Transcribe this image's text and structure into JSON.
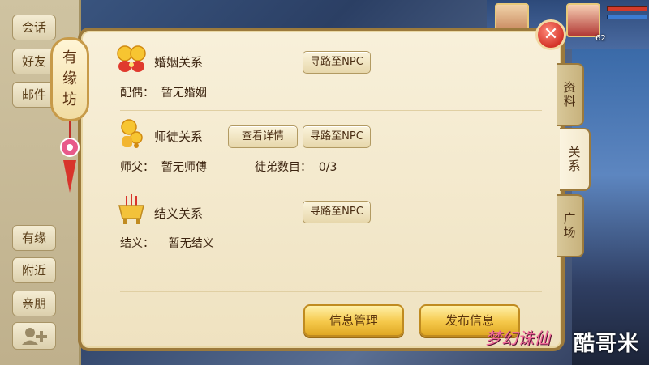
{
  "background": {
    "player_level": "62"
  },
  "left_nav": {
    "top_tabs": [
      "会话",
      "好友",
      "邮件"
    ],
    "bottom_tabs": [
      "有缘",
      "附近",
      "亲朋"
    ]
  },
  "lantern": {
    "chars": [
      "有",
      "缘",
      "坊"
    ]
  },
  "relations": {
    "marriage": {
      "title": "婚姻关系",
      "npc_button": "寻路至NPC",
      "line": "配偶：  暂无婚姻"
    },
    "mentor": {
      "title": "师徒关系",
      "detail_button": "查看详情",
      "npc_button": "寻路至NPC",
      "line_master": "师父：  暂无师傅",
      "line_disciples": "徒弟数目：  0/3"
    },
    "sworn": {
      "title": "结义关系",
      "npc_button": "寻路至NPC",
      "line": "结义：    暂无结义"
    }
  },
  "actions": {
    "info_manage": "信息管理",
    "publish_info": "发布信息"
  },
  "tabs": [
    "资料",
    "关系",
    "广场"
  ],
  "close_label": "✕",
  "watermark": {
    "game_logo": "梦幻诛仙",
    "site": "酷哥米"
  }
}
